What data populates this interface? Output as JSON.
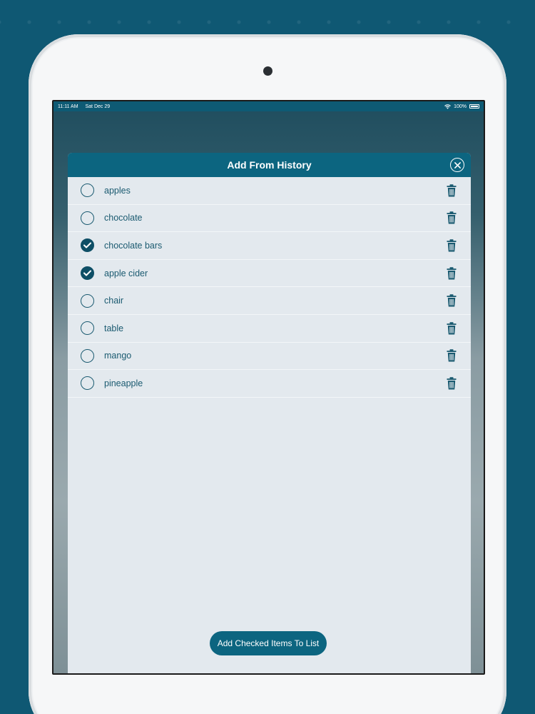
{
  "status_bar": {
    "time": "11:11 AM",
    "date": "Sat Dec 29",
    "battery": "100%"
  },
  "modal": {
    "title": "Add From History",
    "items": [
      {
        "label": "apples",
        "checked": false
      },
      {
        "label": "chocolate",
        "checked": false
      },
      {
        "label": "chocolate bars",
        "checked": true
      },
      {
        "label": "apple cider",
        "checked": true
      },
      {
        "label": "chair",
        "checked": false
      },
      {
        "label": "table",
        "checked": false
      },
      {
        "label": "mango",
        "checked": false
      },
      {
        "label": "pineapple",
        "checked": false
      }
    ],
    "add_button_label": "Add Checked Items To List"
  },
  "colors": {
    "background": "#0f5873",
    "header": "#0c6580",
    "text": "#1a5a70",
    "list_bg": "#e3e9ee"
  }
}
